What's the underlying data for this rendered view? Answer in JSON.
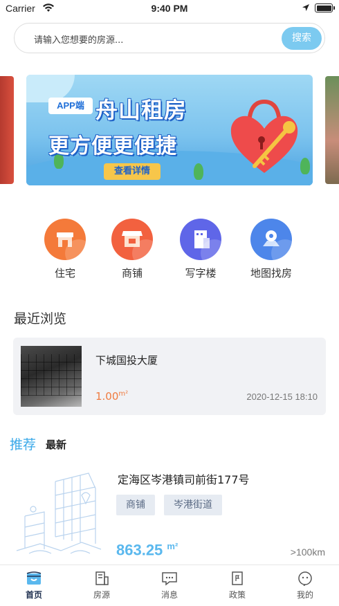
{
  "status_bar": {
    "carrier": "Carrier",
    "time": "9:40 PM"
  },
  "search": {
    "placeholder": "请输入您想要的房源...",
    "button": "搜索"
  },
  "banner": {
    "badge": "APP端",
    "title_line1": "舟山租房",
    "title_line2": "更方便更便捷",
    "detail_button": "查看详情"
  },
  "categories": [
    {
      "label": "住宅",
      "icon": "house-icon",
      "color": "#f47a3a"
    },
    {
      "label": "商铺",
      "icon": "shop-icon",
      "color": "#f2613f"
    },
    {
      "label": "写字楼",
      "icon": "office-building-icon",
      "color": "#5f66e8"
    },
    {
      "label": "地图找房",
      "icon": "map-pin-icon",
      "color": "#4d86ea"
    }
  ],
  "recent": {
    "section_title": "最近浏览",
    "item": {
      "name": "下城国投大厦",
      "area_value": "1.00",
      "area_unit": "m²",
      "date": "2020-12-15 18:10"
    }
  },
  "feed_tabs": {
    "recommend": "推荐",
    "latest": "最新"
  },
  "listing": {
    "title": "定海区岑港镇司前街177号",
    "tags": [
      "商铺",
      "岑港街道"
    ],
    "price_value": "863.25",
    "price_unit": "m²",
    "distance": ">100km"
  },
  "tabbar": [
    {
      "label": "首页",
      "icon": "home-icon",
      "active": true
    },
    {
      "label": "房源",
      "icon": "listings-icon",
      "active": false
    },
    {
      "label": "消息",
      "icon": "message-icon",
      "active": false
    },
    {
      "label": "政策",
      "icon": "policy-flag-icon",
      "active": false
    },
    {
      "label": "我的",
      "icon": "profile-icon",
      "active": false
    }
  ],
  "colors": {
    "accent": "#3aa9e9",
    "search_button": "#7ccaf0",
    "area_orange": "#f07b3f"
  }
}
